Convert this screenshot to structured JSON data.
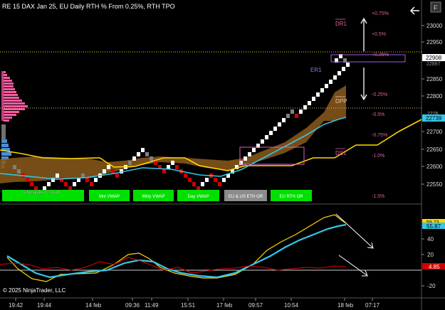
{
  "header": {
    "title": "RE 15 DAX Jan 25, EU Daily RTH % From 0.25%, RTH TPO",
    "f_button": "F"
  },
  "copyright": "© 2025 NinjaTrader, LLC",
  "price_axis": {
    "ticks": [
      "23000",
      "22950",
      "22850",
      "22800",
      "22700",
      "22650",
      "22600",
      "22550"
    ],
    "last_price": "22908",
    "last_price_partial": "22897",
    "cyan_value": "22739",
    "cyan_partial": "2276"
  },
  "percent_levels": [
    "+0.75%",
    "+0.5%",
    "+0.25%",
    "-0.25%",
    "-0.5%",
    "-0.75%",
    "-1.0%",
    "-1.5%"
  ],
  "level_labels": {
    "dr1": "DR1",
    "dpp": "DPP",
    "ds1": "DS1",
    "er1": "ER1"
  },
  "cloud_label": "Outside Cloud",
  "indicator_buttons": [
    {
      "label": "",
      "color": "#00e000"
    },
    {
      "label": "Mnt VWAP",
      "color": "#00e000"
    },
    {
      "label": "Wkly VWAP",
      "color": "#00e000"
    },
    {
      "label": "Day VWAP",
      "color": "#00e000"
    },
    {
      "label": "EU & US ETH OR",
      "color": "#8c8c8c"
    },
    {
      "label": "EU RTH OR",
      "color": "#00e000"
    }
  ],
  "oscillator": {
    "ticks": [
      "40",
      "20",
      "-20"
    ],
    "yellow_value": "59.73",
    "cyan_value": "55.87",
    "red_value": "4.85"
  },
  "time_axis": [
    "19:42",
    "19:44",
    "14 feb",
    "09:36",
    "11:49",
    "15:51",
    "17 feb",
    "09:57",
    "10:54",
    "18 feb",
    "07:17"
  ],
  "colors": {
    "background": "#000000",
    "up_brick": "#ffffff",
    "down_brick": "#d00000",
    "neutral_brick": "#808080",
    "vwap_yellow": "#ffd700",
    "cyan_line": "#34c8e8",
    "cloud_brown": "#8b5a1a",
    "magenta": "#e060c0",
    "pink_levels": "#e0609c",
    "violet_label": "#8c7cf0"
  }
}
